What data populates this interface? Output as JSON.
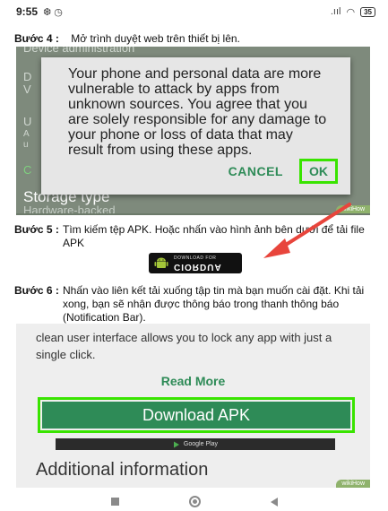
{
  "status_bar": {
    "time": "9:55",
    "notif_icons": "❆ ◷",
    "signal": ".ııl",
    "wifi": "◠",
    "battery": "35"
  },
  "step4": {
    "label": "Bước 4 :",
    "text": "Mở trình duyệt web trên thiết bị lên."
  },
  "screenshot1": {
    "bg_header": "Device administration",
    "bg_d": "D",
    "bg_v": "V",
    "bg_u": "U",
    "bg_a": "A",
    "bg_u2": "u",
    "bg_c": "C",
    "storage_type": "Storage type",
    "hardware_backed": "Hardware-backed",
    "dialog_text": "Your phone and personal data are more vulnerable to attack by apps from unknown sources. You agree that you are solely responsible for any damage to your phone or loss of data that may result from using these apps.",
    "cancel": "CANCEL",
    "ok": "OK",
    "wikihow": "wikiHow"
  },
  "step5": {
    "label": "Bước 5 :",
    "text": "Tìm kiếm tệp APK. Hoặc nhấn vào hình ảnh bên dưới để tải file APK"
  },
  "download_badge": {
    "small": "DOWNLOAD FOR",
    "big": "CIORDUA"
  },
  "step6": {
    "label": "Bước 6 :",
    "text": "Nhấn vào liên kết tải xuống tập tin mà bạn muốn cài đặt. Khi tải xong, bạn sẽ nhận được thông báo trong thanh thông báo (Notification Bar)."
  },
  "screenshot2": {
    "description": "clean user interface allows you to lock any app with just a single click.",
    "read_more": "Read More",
    "download_apk": "Download APK",
    "google_play": "Google Play",
    "additional_info": "Additional information",
    "wikihow": "wikiHow"
  },
  "colors": {
    "accent_green": "#2e8b57",
    "highlight_green": "#39e400",
    "arrow_red": "#e8453c"
  }
}
